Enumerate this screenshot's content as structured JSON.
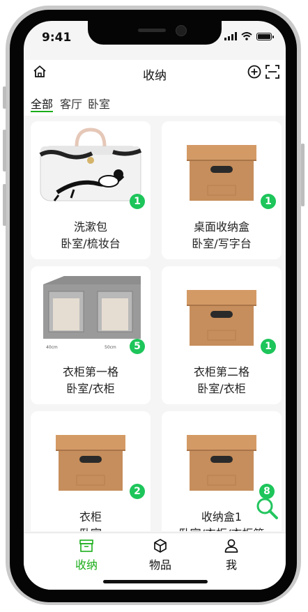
{
  "status_bar": {
    "time": "9:41"
  },
  "header": {
    "title": "收纳"
  },
  "tabs": [
    {
      "label": "全部",
      "active": true
    },
    {
      "label": "客厅",
      "active": false
    },
    {
      "label": "卧室",
      "active": false
    }
  ],
  "cards": [
    {
      "name": "洗漱包",
      "location": "卧室/梳妆台",
      "count": "1",
      "image": "toiletry-bag"
    },
    {
      "name": "桌面收纳盒",
      "location": "卧室/写字台",
      "count": "1",
      "image": "cardboard-box"
    },
    {
      "name": "衣柜第一格",
      "location": "卧室/衣柜",
      "count": "5",
      "image": "fabric-storage-box"
    },
    {
      "name": "衣柜第二格",
      "location": "卧室/衣柜",
      "count": "1",
      "image": "cardboard-box"
    },
    {
      "name": "衣柜",
      "location": "卧室",
      "count": "2",
      "image": "cardboard-box"
    },
    {
      "name": "收纳盒1",
      "location": "卧室/衣柜/衣柜第",
      "count": "8",
      "image": "cardboard-box"
    }
  ],
  "image_labels": {
    "dim1": "40cm",
    "dim2": "50cm"
  },
  "tabbar": {
    "items": [
      {
        "label": "收纳",
        "icon": "storage-icon",
        "active": true
      },
      {
        "label": "物品",
        "icon": "cube-icon",
        "active": false
      },
      {
        "label": "我",
        "icon": "user-icon",
        "active": false
      }
    ]
  },
  "colors": {
    "accent": "#1aad19",
    "badge": "#1dc55a",
    "background": "#f5f5f5"
  }
}
